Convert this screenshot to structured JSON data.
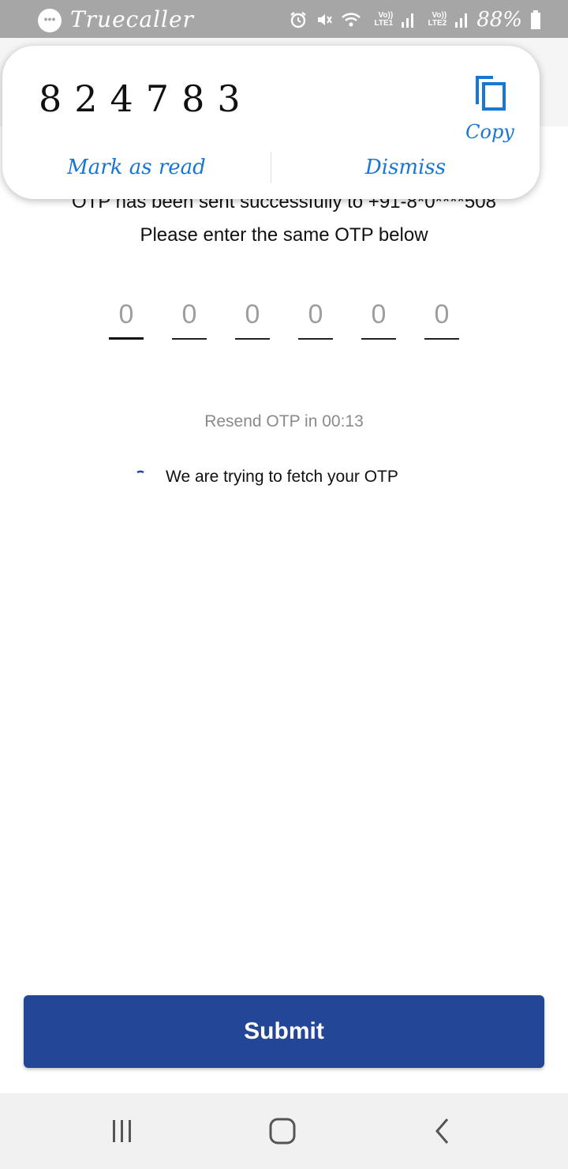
{
  "status_bar": {
    "app_name": "Truecaller",
    "net1_label": "Vo)) LTE1",
    "net2_label": "Vo)) LTE2",
    "battery": "88%"
  },
  "notification": {
    "otp_code": "824783",
    "copy_label": "Copy",
    "mark_as_read": "Mark as read",
    "dismiss": "Dismiss"
  },
  "main": {
    "sent_message": "OTP has been sent successfully to +91-8*0****508",
    "enter_message": "Please enter the same OTP below",
    "otp_digits": [
      "0",
      "0",
      "0",
      "0",
      "0",
      "0"
    ],
    "resend_text": "Resend OTP in 00:13",
    "fetch_text": "We are trying to fetch your OTP",
    "submit_label": "Submit"
  },
  "colors": {
    "accent": "#234796",
    "link": "#1976d2",
    "status_bar": "#a6a6a6"
  },
  "icons": [
    "message-icon",
    "alarm-icon",
    "mute-icon",
    "wifi-icon",
    "signal-icon",
    "battery-icon",
    "copy-icon",
    "spinner-icon",
    "recents-icon",
    "home-icon",
    "back-icon"
  ]
}
